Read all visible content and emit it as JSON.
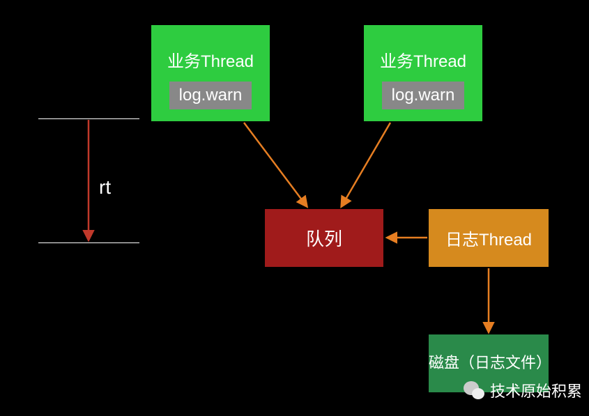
{
  "thread1": {
    "title": "业务Thread",
    "log": "log.warn"
  },
  "thread2": {
    "title": "业务Thread",
    "log": "log.warn"
  },
  "queue": {
    "label": "队列"
  },
  "logThread": {
    "label": "日志Thread"
  },
  "disk": {
    "label": "磁盘（日志文件）"
  },
  "rt": {
    "label": "rt"
  },
  "watermark": {
    "text": "技术原始积累"
  },
  "colors": {
    "green": "#2ecc40",
    "darkRed": "#a01b1b",
    "orange": "#d68a1e",
    "diskGreen": "#2a8a4a",
    "arrowOrange": "#e67e22",
    "arrowRed": "#c0392b"
  }
}
